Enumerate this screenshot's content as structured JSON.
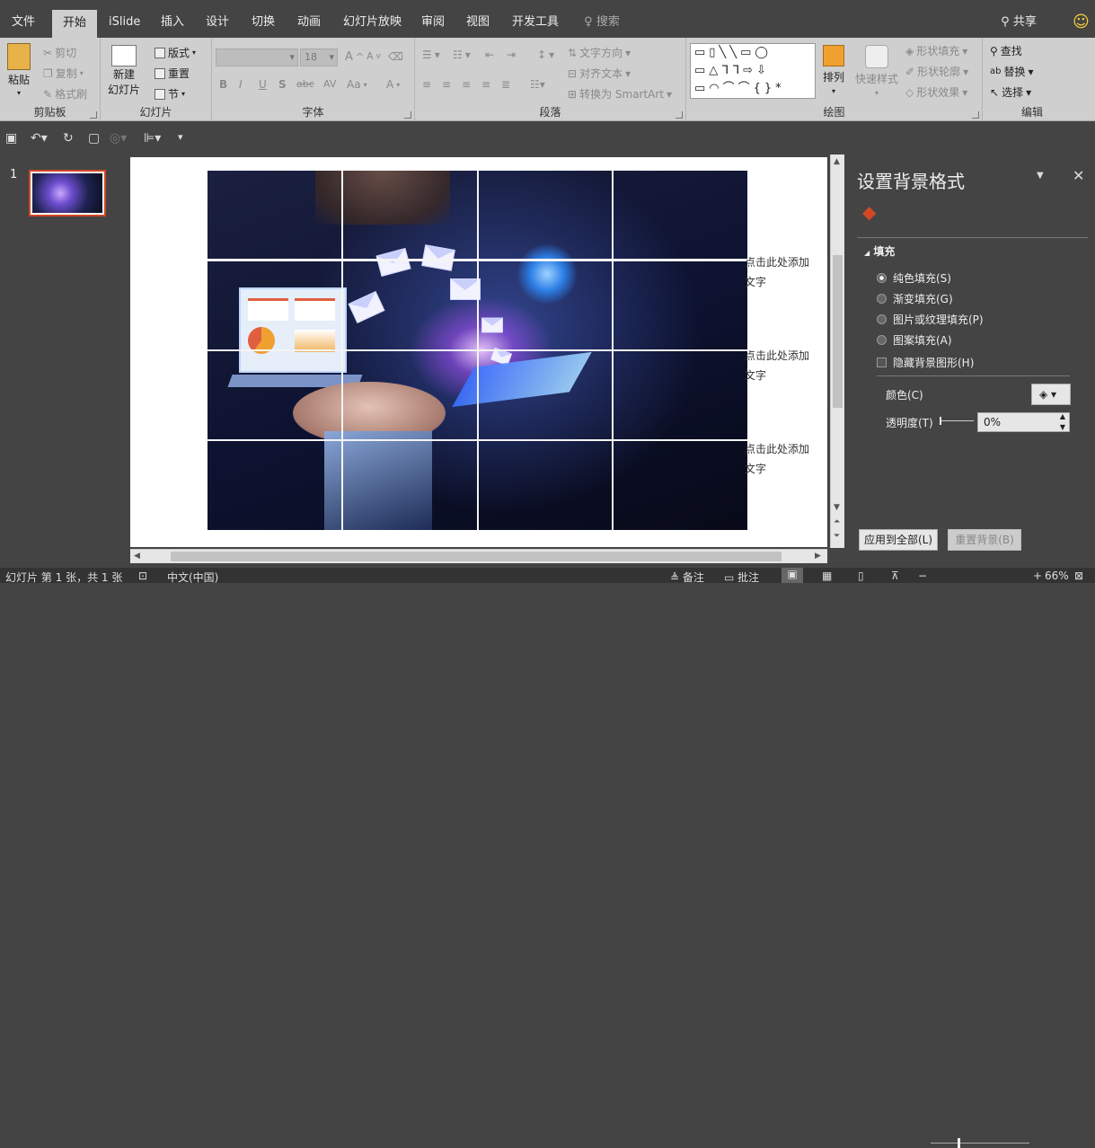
{
  "tabs": [
    "文件",
    "开始",
    "iSlide",
    "插入",
    "设计",
    "切换",
    "动画",
    "幻灯片放映",
    "审阅",
    "视图",
    "开发工具",
    "搜索"
  ],
  "account": "共享",
  "ribbon": {
    "clipboard": {
      "paste": "粘贴",
      "cut": "剪切",
      "copy": "复制",
      "format_painter": "格式刷",
      "label": "剪贴板"
    },
    "slides": {
      "new_slide_l1": "新建",
      "new_slide_l2": "幻灯片",
      "layout": "版式",
      "reset": "重置",
      "section": "节",
      "label": "幻灯片"
    },
    "font": {
      "font_name": "",
      "font_size": "18",
      "label": "字体",
      "bold": "B",
      "italic": "I",
      "underline": "U",
      "shadow": "S",
      "strike": "abc",
      "spacing": "AV",
      "case": "Aa",
      "color": "A"
    },
    "paragraph": {
      "text_direction": "文字方向",
      "align_text": "对齐文本",
      "smartart": "转换为 SmartArt",
      "label": "段落"
    },
    "drawing": {
      "arrange": "排列",
      "quick_styles": "快速样式",
      "shape_fill": "形状填充",
      "shape_outline": "形状轮廓",
      "shape_effects": "形状效果",
      "label": "绘图"
    },
    "editing": {
      "find": "查找",
      "replace": "替换",
      "select": "选择",
      "label": "编辑"
    }
  },
  "thumbnail": {
    "number": "1"
  },
  "slide": {
    "placeholder_l1": "点击此处添加",
    "placeholder_l2": "文字"
  },
  "pane": {
    "title": "设置背景格式",
    "section": "填充",
    "options": [
      "纯色填充(S)",
      "渐变填充(G)",
      "图片或纹理填充(P)",
      "图案填充(A)"
    ],
    "selected_option": "纯色填充(S)",
    "hide_bg": "隐藏背景图形(H)",
    "color_label": "颜色(C)",
    "transparency_label": "透明度(T)",
    "transparency_value": "0%",
    "apply_all": "应用到全部(L)",
    "reset_bg": "重置背景(B)"
  },
  "status": {
    "slide_info": "幻灯片 第 1 张，共 1 张",
    "language": "中文(中国)",
    "notes": "备注",
    "comments": "批注",
    "zoom": "66%"
  },
  "colors": {
    "accent": "#d24726",
    "ribbon_bg": "#cfcfcf",
    "dark_bg": "#444444"
  }
}
